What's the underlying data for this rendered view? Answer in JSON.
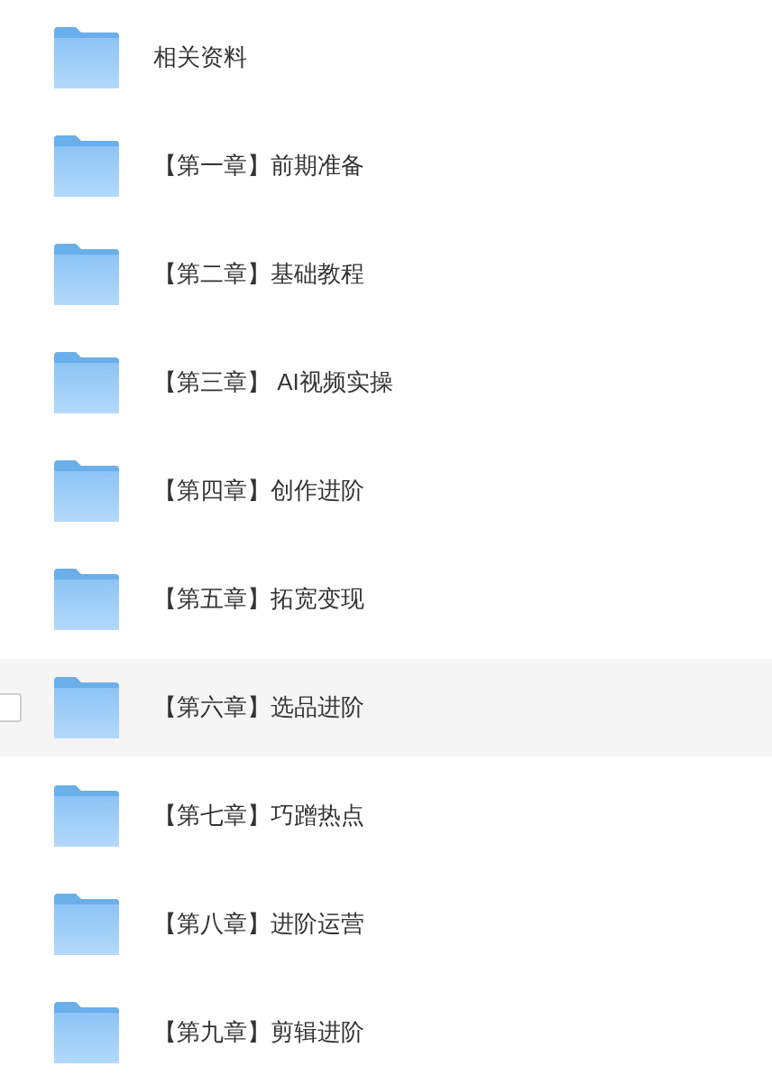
{
  "folders": [
    {
      "name": "相关资料",
      "hovered": false
    },
    {
      "name": "【第一章】前期准备",
      "hovered": false
    },
    {
      "name": "【第二章】基础教程",
      "hovered": false
    },
    {
      "name": "【第三章】 AI视频实操",
      "hovered": false
    },
    {
      "name": "【第四章】创作进阶",
      "hovered": false
    },
    {
      "name": "【第五章】拓宽变现",
      "hovered": false
    },
    {
      "name": "【第六章】选品进阶",
      "hovered": true
    },
    {
      "name": "【第七章】巧蹭热点",
      "hovered": false
    },
    {
      "name": "【第八章】进阶运营",
      "hovered": false
    },
    {
      "name": "【第九章】剪辑进阶",
      "hovered": false
    }
  ]
}
